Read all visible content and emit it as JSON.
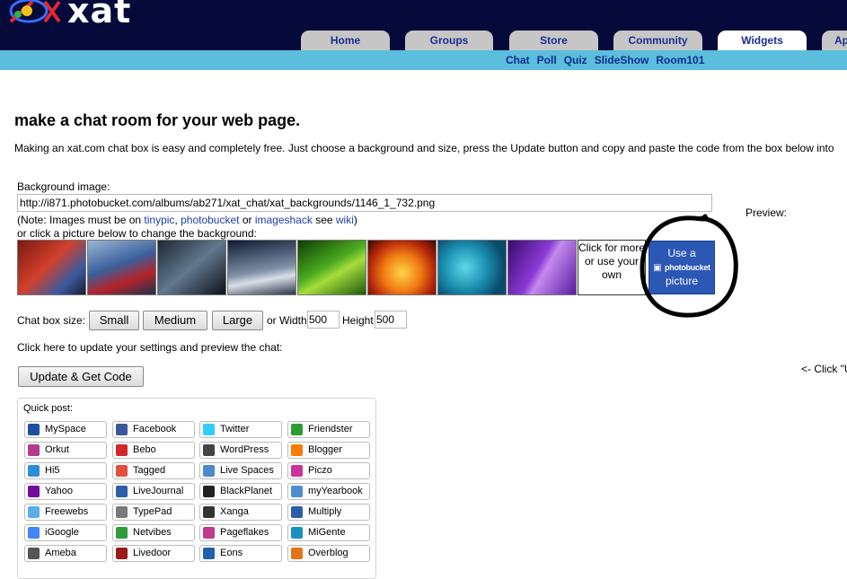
{
  "header": {
    "logo_text": "xat",
    "tabs": [
      "Home",
      "Groups",
      "Store",
      "Community",
      "Widgets",
      "Ap"
    ],
    "active_tab": "Widgets",
    "sublinks": [
      "Chat",
      "Poll",
      "Quiz",
      "SlideShow",
      "Room101"
    ]
  },
  "main": {
    "title": "make a chat room for your web page.",
    "intro": "Making an xat.com chat box is easy and completely free. Just choose a background and size, press the Update button and copy and paste the code from the box below into",
    "bg_label": "Background image:",
    "bg_url": "http://i871.photobucket.com/albums/ab271/xat_chat/xat_backgrounds/1146_1_732.png",
    "note_prefix": "(Note: Images must be on ",
    "note_link1": "tinypic",
    "note_sep1": ", ",
    "note_link2": "photobucket",
    "note_sep2": " or ",
    "note_link3": "imageshack",
    "note_sep3": " see ",
    "note_link4": "wiki",
    "note_suffix": ")",
    "pick_text": "or click a picture below to change the background:",
    "preview_label": "Preview:",
    "click_for_more": "Click for more or use your own",
    "use_a": "Use a",
    "photobucket": "photobucket",
    "picture": "picture",
    "chat_size_label": "Chat box size:",
    "size_buttons": [
      "Small",
      "Medium",
      "Large"
    ],
    "or_width": "or Width",
    "width_value": "500",
    "height_label": "Height",
    "height_value": "500",
    "update_text": "Click here to update your settings and preview the chat:",
    "update_button": "Update & Get Code",
    "click_u": "<- Click \"U"
  },
  "quick_post": {
    "title": "Quick post:",
    "items": [
      [
        "MySpace",
        "Facebook",
        "Twitter",
        "Friendster"
      ],
      [
        "Orkut",
        "Bebo",
        "WordPress",
        "Blogger"
      ],
      [
        "Hi5",
        "Tagged",
        "Live Spaces",
        "Piczo"
      ],
      [
        "Yahoo",
        "LiveJournal",
        "BlackPlanet",
        "myYearbook"
      ],
      [
        "Freewebs",
        "TypePad",
        "Xanga",
        "Multiply"
      ],
      [
        "iGoogle",
        "Netvibes",
        "Pageflakes",
        "MiGente"
      ],
      [
        "Ameba",
        "Livedoor",
        "Eons",
        "Overblog"
      ]
    ],
    "icon_colors": [
      [
        "#1c4fa0",
        "#3b5998",
        "#33ccff",
        "#2e9c34"
      ],
      [
        "#b23b8c",
        "#d0282a",
        "#444444",
        "#f57d00"
      ],
      [
        "#2a8fd8",
        "#e0513d",
        "#4d8ac8",
        "#cc3399"
      ],
      [
        "#720e9e",
        "#2c5fa6",
        "#222222",
        "#4e8fd1"
      ],
      [
        "#5ab0e6",
        "#7a7a7a",
        "#333333",
        "#2a5fa8"
      ],
      [
        "#4285f4",
        "#2f9b3a",
        "#c03a8b",
        "#1c8fbf"
      ],
      [
        "#555555",
        "#9b1b1b",
        "#1e5fae",
        "#e27318"
      ]
    ]
  }
}
